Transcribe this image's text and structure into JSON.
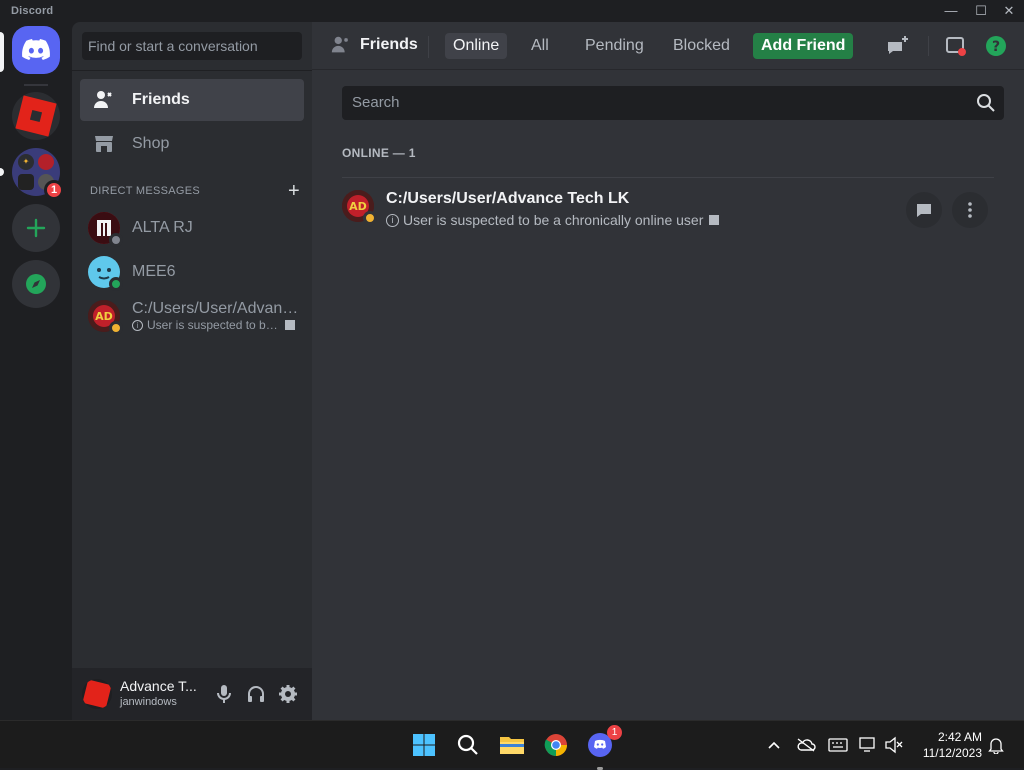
{
  "app": {
    "title": "Discord"
  },
  "window_controls": {
    "minimize": "—",
    "maximize": "☐",
    "close": "✕"
  },
  "sidebar": {
    "search_placeholder": "Find or start a conversation",
    "nav": [
      {
        "label": "Friends",
        "icon": "friends-wave-icon"
      },
      {
        "label": "Shop",
        "icon": "shop-icon"
      }
    ],
    "dm_header": "DIRECT MESSAGES",
    "dm_add": "+",
    "dms": [
      {
        "name": "ALTA RJ",
        "status": "offline"
      },
      {
        "name": "MEE6",
        "status": "online"
      },
      {
        "name": "C:/Users/User/Advance Tech LK",
        "sub": "User is suspected to be a chronically online user",
        "status": "idle"
      }
    ]
  },
  "guilds": {
    "server_badge": "1"
  },
  "user_panel": {
    "name": "Advance T...",
    "tag": "janwindows"
  },
  "topbar": {
    "title": "Friends",
    "tabs": [
      "Online",
      "All",
      "Pending",
      "Blocked"
    ],
    "add_friend": "Add Friend"
  },
  "friends": {
    "search_placeholder": "Search",
    "section_label": "ONLINE — 1",
    "list": [
      {
        "name": "C:/Users/User/Advance Tech LK",
        "status_text": "User is suspected to be a chronically online user"
      }
    ]
  },
  "taskbar": {
    "discord_badge": "1",
    "time": "2:42 AM",
    "date": "11/12/2023"
  },
  "colors": {
    "blurple": "#5865f2",
    "green": "#23a55a",
    "add_friend_green": "#248046",
    "idle": "#f0b232",
    "red": "#ed4245"
  }
}
